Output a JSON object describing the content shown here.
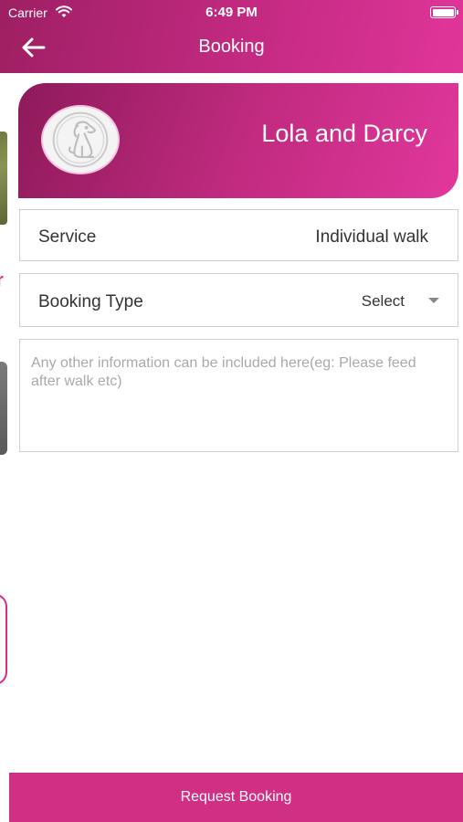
{
  "status_bar": {
    "carrier": "Carrier",
    "time": "6:49 PM"
  },
  "nav": {
    "title": "Booking",
    "back_icon": "arrow-left-icon"
  },
  "pet": {
    "name": "Lola and Darcy",
    "avatar_icon": "dog-icon"
  },
  "service": {
    "label": "Service",
    "value": "Individual walk"
  },
  "booking_type": {
    "label": "Booking Type",
    "selected": "Select"
  },
  "notes": {
    "placeholder": "Any other information can be included here(eg: Please feed after walk etc)",
    "value": ""
  },
  "background_peek": {
    "fragment_text": "r"
  },
  "request_button": {
    "label": "Request Booking"
  },
  "colors": {
    "accent": "#d12f84",
    "header_start": "#9e1f63",
    "header_end": "#e0359a"
  }
}
